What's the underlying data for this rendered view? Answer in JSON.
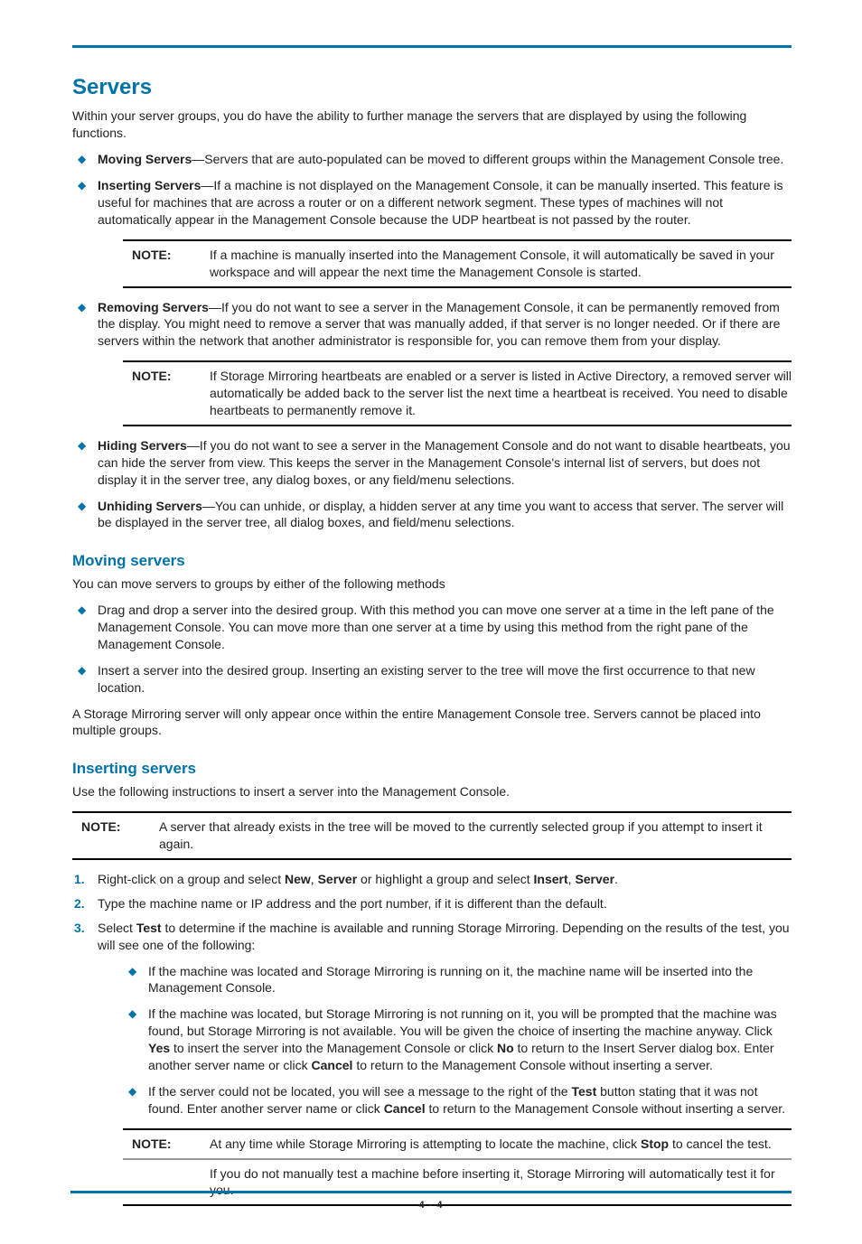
{
  "title": "Servers",
  "intro": "Within your server groups, you do have the ability to further manage the servers that are displayed by using the following functions.",
  "topList": [
    {
      "lead": "Moving Servers",
      "text": "—Servers that are auto-populated can be moved to different groups within the Management Console tree."
    },
    {
      "lead": "Inserting Servers",
      "text": "—If a machine is not displayed on the Management Console, it can be manually inserted. This feature is useful for machines that are across a router or on a different network segment. These types of machines will not automatically appear in the Management Console because the UDP heartbeat is not passed by the router.",
      "note": "If a machine is manually inserted into the Management Console, it will automatically be saved in your workspace and will appear the next time the Management Console is started."
    },
    {
      "lead": "Removing Servers",
      "text": "—If you do not want to see a server in the Management Console, it can be permanently removed from the display. You might need to remove a server that was manually added, if that server is no longer needed. Or if there are servers within the network that another administrator is responsible for, you can remove them from your display.",
      "note": "If Storage Mirroring heartbeats are enabled or a server is listed in Active Directory, a removed server will automatically be added back to the server list the next time a heartbeat is received. You need to disable heartbeats to permanently remove it."
    },
    {
      "lead": "Hiding Servers",
      "text": "—If you do not want to see a server in the Management Console and do not want to disable heartbeats, you can hide the server from view. This keeps the server in the Management Console's internal list of servers, but does not display it in the server tree, any dialog boxes, or any field/menu selections."
    },
    {
      "lead": "Unhiding Servers",
      "text": "—You can unhide, or display, a hidden server at any time you want to access that server. The server will be displayed in the server tree, all dialog boxes, and field/menu selections."
    }
  ],
  "noteLabel": "NOTE:",
  "moving": {
    "title": "Moving servers",
    "intro": "You can move servers to groups by either of the following methods",
    "items": [
      "Drag and drop a server into the desired group. With this method you can move one server at a time in the left pane of the Management Console. You can move more than one server at a time by using this method from the right pane of the Management Console.",
      "Insert a server into the desired group. Inserting an existing server to the tree will move the first occurrence to that new location."
    ],
    "outro": "A Storage Mirroring server will only appear once within the entire Management Console tree. Servers cannot be placed into multiple groups."
  },
  "inserting": {
    "title": "Inserting servers",
    "intro": "Use the following instructions to insert a server into the Management Console.",
    "note1": "A server that already exists in the tree will be moved to the currently selected group if you attempt to insert it again.",
    "step1": {
      "pre": "Right-click on a group and select ",
      "b1": "New",
      "sep1": ", ",
      "b2": "Server",
      "mid": " or highlight a group and select ",
      "b3": "Insert",
      "sep2": ", ",
      "b4": "Server",
      "post": "."
    },
    "step2": "Type the machine name or IP address and the port number, if it is different than the default.",
    "step3": {
      "pre": "Select ",
      "b1": "Test",
      "post": " to determine if the machine is available and running Storage Mirroring. Depending on the results of the test, you will see one of the following:"
    },
    "sub": {
      "a": "If the machine was located and Storage Mirroring is running on it, the machine name will be inserted into the Management Console.",
      "b": {
        "p1": "If the machine was located, but Storage Mirroring is not running on it, you will be prompted that the machine was found, but Storage Mirroring is not available. You will be given the choice of inserting the machine anyway. Click ",
        "yes": "Yes",
        "p2": " to insert the server into the Management Console or click ",
        "no": "No",
        "p3": " to return to the Insert Server dialog box. Enter another server name or click ",
        "cancel": "Cancel",
        "p4": " to return to the Management Console without inserting a server."
      },
      "c": {
        "p1": "If the server could not be located, you will see a message to the right of the ",
        "test": "Test",
        "p2": " button stating that it was not found. Enter another server name or click ",
        "cancel": "Cancel",
        "p3": " to return to the Management Console without inserting a server."
      }
    },
    "note2a": {
      "p1": "At any time while Storage Mirroring is attempting to locate the machine, click ",
      "stop": "Stop",
      "p2": " to cancel the test."
    },
    "note2b": "If you do not manually test a machine before inserting it, Storage Mirroring will automatically test it for you."
  },
  "pageNumber": "4 - 4"
}
